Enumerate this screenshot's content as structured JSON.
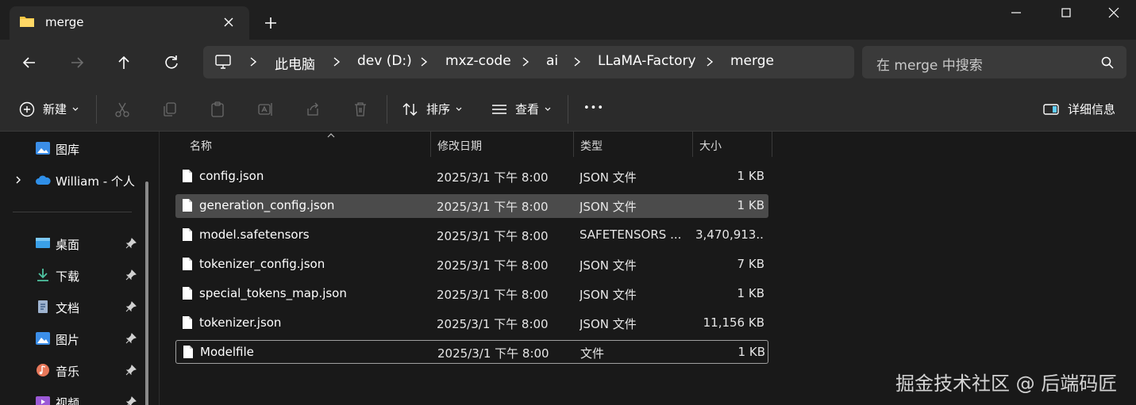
{
  "tab": {
    "title": "merge"
  },
  "breadcrumb": [
    "此电脑",
    "dev (D:)",
    "mxz-code",
    "ai",
    "LLaMA-Factory",
    "merge"
  ],
  "search": {
    "placeholder": "在 merge 中搜索"
  },
  "toolbar": {
    "new_label": "新建",
    "sort_label": "排序",
    "view_label": "查看",
    "more_label": "•••",
    "details_label": "详细信息"
  },
  "sidebar": {
    "items": [
      {
        "label": "图库",
        "icon": "gallery-icon"
      },
      {
        "label": "William - 个人",
        "icon": "onedrive-cloud-icon"
      },
      {
        "label": "桌面",
        "icon": "desktop-icon",
        "pinned": true
      },
      {
        "label": "下载",
        "icon": "download-icon",
        "pinned": true
      },
      {
        "label": "文档",
        "icon": "documents-icon",
        "pinned": true
      },
      {
        "label": "图片",
        "icon": "pictures-icon",
        "pinned": true
      },
      {
        "label": "音乐",
        "icon": "music-icon",
        "pinned": true
      },
      {
        "label": "视频",
        "icon": "videos-icon",
        "pinned": true
      }
    ]
  },
  "columns": {
    "name": "名称",
    "date": "修改日期",
    "type": "类型",
    "size": "大小"
  },
  "files": [
    {
      "name": "config.json",
      "date": "2025/3/1 下午 8:00",
      "type": "JSON 文件",
      "size": "1 KB"
    },
    {
      "name": "generation_config.json",
      "date": "2025/3/1 下午 8:00",
      "type": "JSON 文件",
      "size": "1 KB"
    },
    {
      "name": "model.safetensors",
      "date": "2025/3/1 下午 8:00",
      "type": "SAFETENSORS ...",
      "size": "3,470,913..."
    },
    {
      "name": "tokenizer_config.json",
      "date": "2025/3/1 下午 8:00",
      "type": "JSON 文件",
      "size": "7 KB"
    },
    {
      "name": "special_tokens_map.json",
      "date": "2025/3/1 下午 8:00",
      "type": "JSON 文件",
      "size": "1 KB"
    },
    {
      "name": "tokenizer.json",
      "date": "2025/3/1 下午 8:00",
      "type": "JSON 文件",
      "size": "11,156 KB"
    },
    {
      "name": "Modelfile",
      "date": "2025/3/1 下午 8:00",
      "type": "文件",
      "size": "1 KB"
    }
  ],
  "watermark": "掘金技术社区 @ 后端码匠",
  "colors": {
    "window_bg": "#191919",
    "chrome_bg": "#2b2b2b",
    "selected_row": "#4b4b4b",
    "folder_yellow": "#f5c542",
    "accent": "#60cdff"
  }
}
